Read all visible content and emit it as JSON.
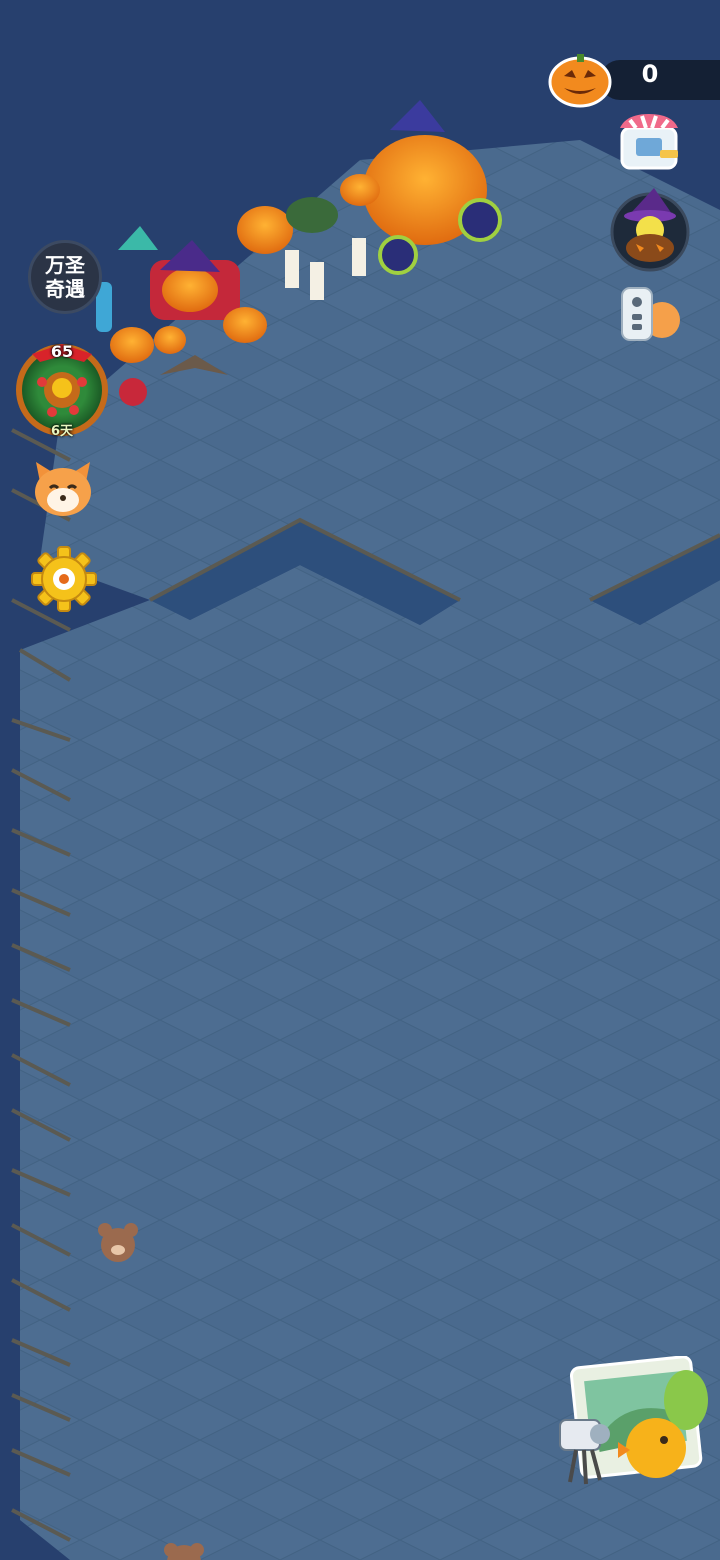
{
  "hud": {
    "pumpkin_counter": "0"
  },
  "event": {
    "title_line1": "万圣",
    "title_line2": "奇遇"
  },
  "level_badge": {
    "level": "65",
    "days_left": "6天"
  },
  "icons": {
    "top_right": [
      "pumpkin-currency-icon",
      "shop-icon",
      "witch-event-icon",
      "remote-control-icon"
    ],
    "left": [
      "event-badge",
      "wreath-level-icon",
      "cat-friend-icon",
      "settings-gear-icon"
    ],
    "bottom_right": "camera-album-icon"
  },
  "colors": {
    "water": "#27406e",
    "floor_tile": "#4a6a8e",
    "counter_bg": "#142034",
    "pumpkin": "#f28a1e",
    "gear": "#f5c21a"
  }
}
